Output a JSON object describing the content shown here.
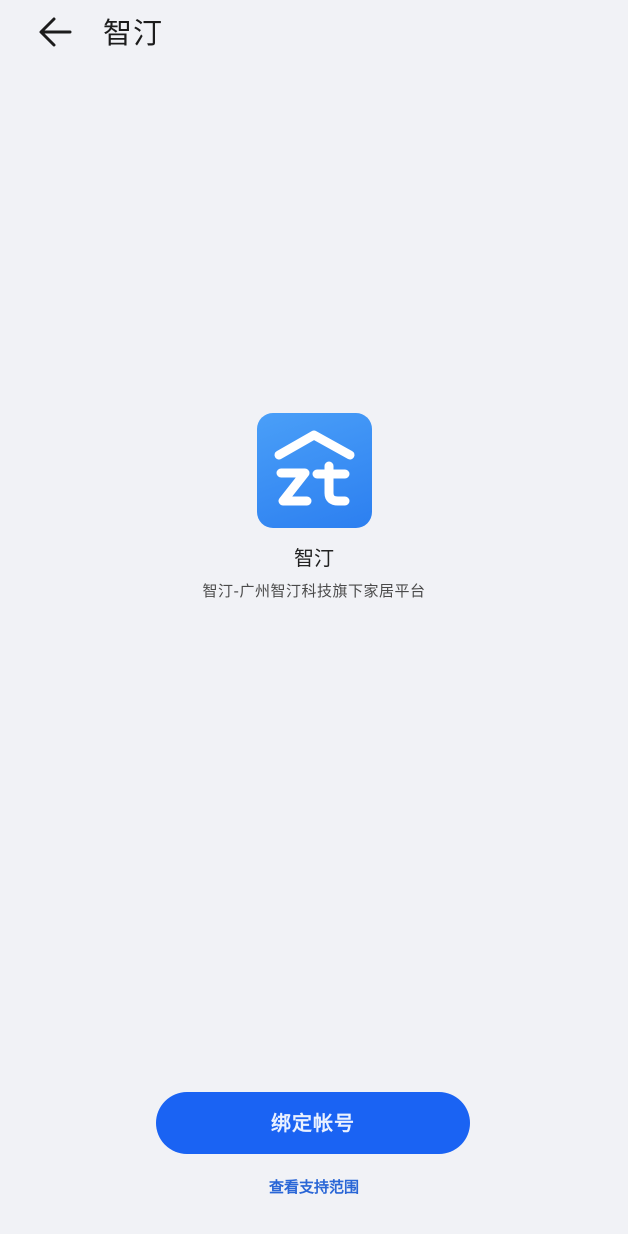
{
  "header": {
    "back_icon": "arrow-left-icon",
    "title": "智汀"
  },
  "app": {
    "icon_name": "zt-logo-icon",
    "icon_colors": [
      "#4a9ff8",
      "#2c7ff0"
    ],
    "name": "智汀",
    "description": "智汀-广州智汀科技旗下家居平台"
  },
  "actions": {
    "bind_label": "绑定帐号",
    "support_label": "查看支持范围"
  },
  "colors": {
    "background": "#f1f2f6",
    "primary": "#1a63f3",
    "link": "#2a66d6"
  }
}
